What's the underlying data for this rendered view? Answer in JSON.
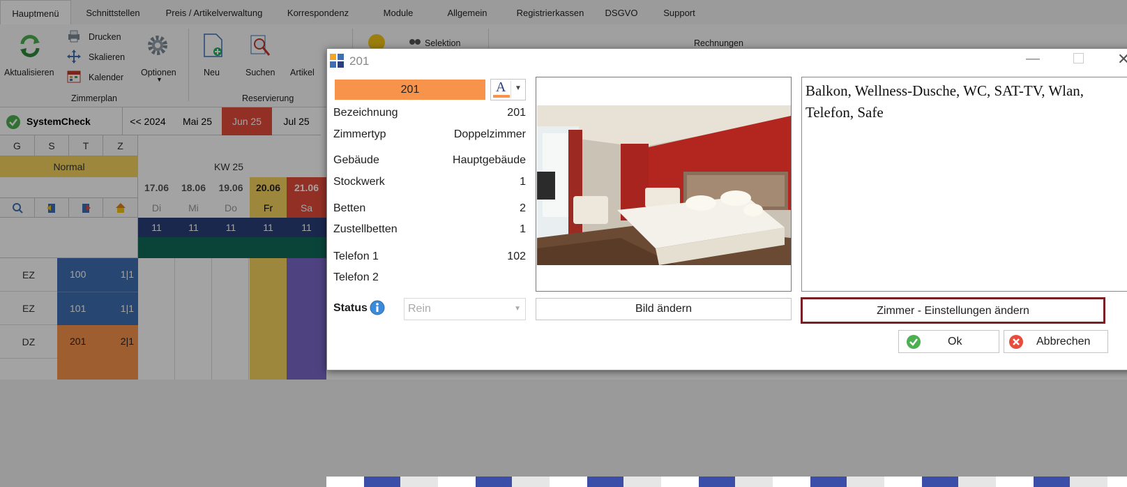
{
  "app": {
    "tabs": [
      "Hauptmenü",
      "Schnittstellen",
      "Preis / Artikelverwaltung",
      "Korrespondenz",
      "Module",
      "Allgemein",
      "Registrierkassen",
      "DSGVO",
      "Support"
    ],
    "ribbon": {
      "refresh_label": "Aktualisieren",
      "print_label": "Drucken",
      "scale_label": "Skalieren",
      "calendar_label": "Kalender",
      "options_label": "Optionen",
      "group_zimmerplan": "Zimmerplan",
      "new_label": "Neu",
      "search_label": "Suchen",
      "article_label": "Artikel",
      "group_reservierung": "Reservierung",
      "selection_label": "Selektion",
      "invoices_label": "Rechnungen"
    },
    "systemcheck_label": "SystemCheck",
    "months": [
      "<< 2024",
      "Mai 25",
      "Jun 25",
      "Jul 25"
    ],
    "col_heads": [
      "G",
      "S",
      "T",
      "Z"
    ],
    "category": "Normal",
    "week": "KW 25",
    "dates": [
      "17.06",
      "18.06",
      "19.06",
      "20.06",
      "21.06"
    ],
    "weekdays": [
      "Di",
      "Mi",
      "Do",
      "Fr",
      "Sa"
    ],
    "counts": [
      "11",
      "11",
      "11",
      "11",
      "11"
    ],
    "rooms": [
      {
        "type": "EZ",
        "number": "100",
        "occ": "1|1"
      },
      {
        "type": "EZ",
        "number": "101",
        "occ": "1|1"
      },
      {
        "type": "DZ",
        "number": "201",
        "occ": "2|1"
      }
    ],
    "accent_orange": "#f7934a",
    "accent_blue": "#3d6fb2",
    "accent_red": "#e74c3c"
  },
  "dialog": {
    "title": "201",
    "room_badge": "201",
    "color_letter": "A",
    "fields": [
      {
        "label": "Bezeichnung",
        "value": "201"
      },
      {
        "label": "Zimmertyp",
        "value": "Doppelzimmer"
      },
      {
        "label": "Gebäude",
        "value": "Hauptgebäude"
      },
      {
        "label": "Stockwerk",
        "value": "1"
      },
      {
        "label": "Betten",
        "value": "2"
      },
      {
        "label": "Zustellbetten",
        "value": "1"
      },
      {
        "label": "Telefon 1",
        "value": "102"
      },
      {
        "label": "Telefon 2",
        "value": ""
      }
    ],
    "status_label": "Status",
    "status_value": "Rein",
    "description": "Balkon, Wellness-Dusche, WC, SAT-TV, Wlan, Telefon, Safe",
    "change_image_label": "Bild ändern",
    "room_settings_label": "Zimmer - Einstellungen ändern",
    "ok_label": "Ok",
    "cancel_label": "Abbrechen"
  }
}
